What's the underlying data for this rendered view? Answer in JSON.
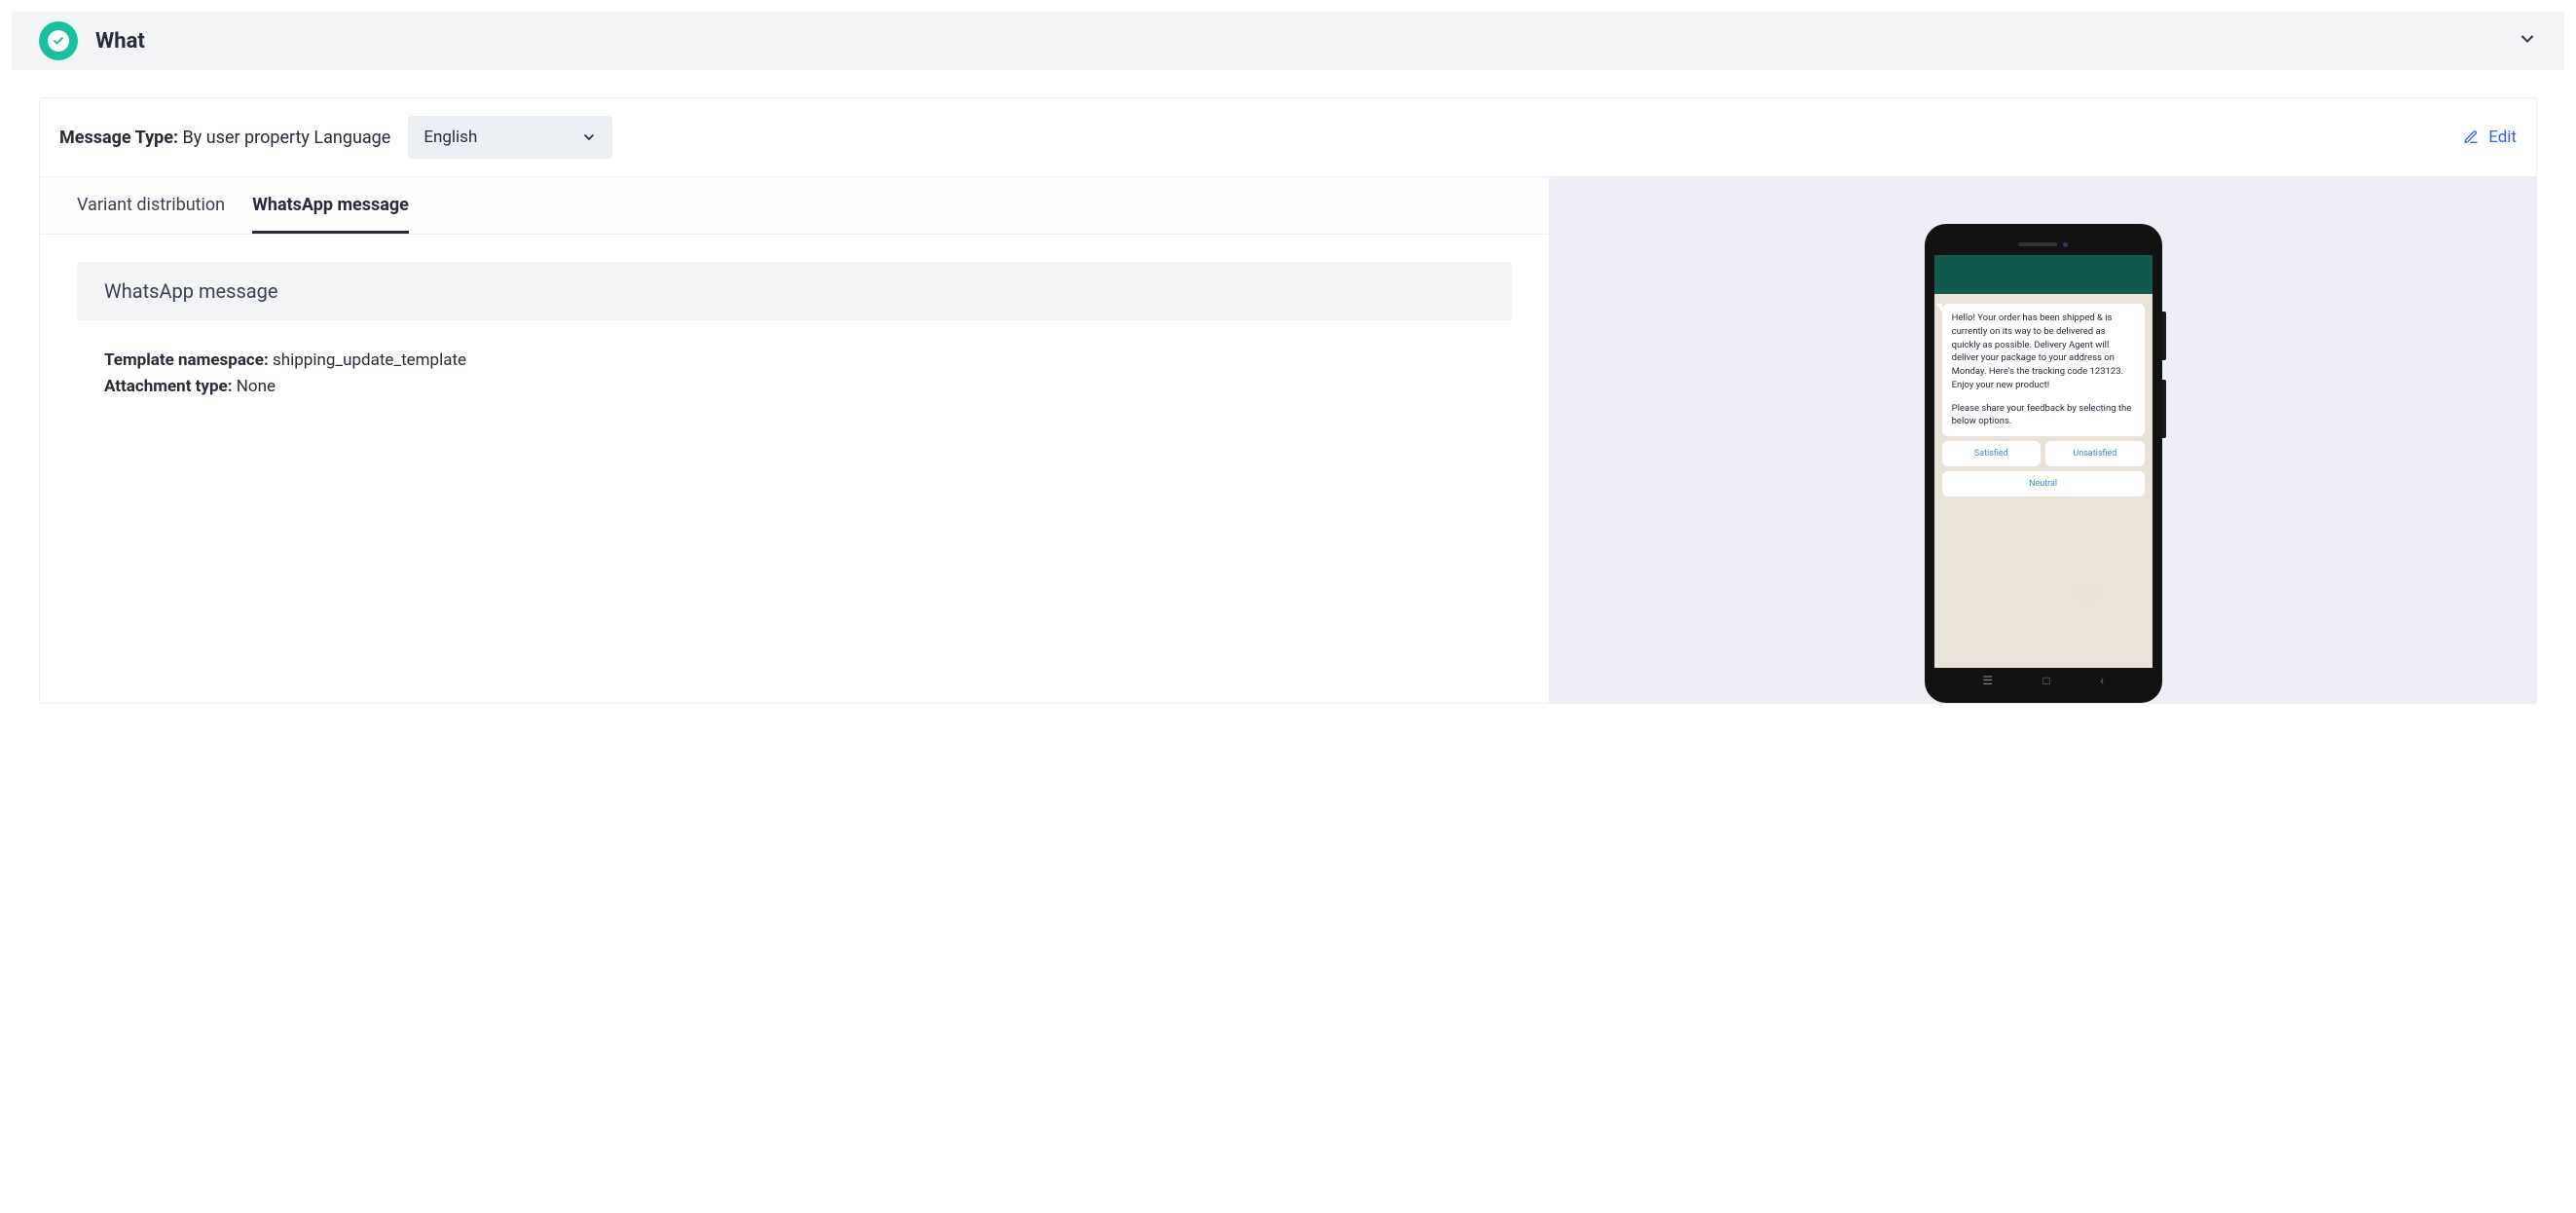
{
  "section": {
    "title": "What"
  },
  "messageType": {
    "label_prefix": "Message Type:",
    "label_value": "By user property Language",
    "selected_language": "English"
  },
  "edit_label": "Edit",
  "tabs": [
    {
      "label": "Variant distribution",
      "active": false
    },
    {
      "label": "WhatsApp message",
      "active": true
    }
  ],
  "subheader": "WhatsApp message",
  "template": {
    "namespace_label": "Template namespace:",
    "namespace_value": "shipping_update_template",
    "attachment_label": "Attachment type:",
    "attachment_value": "None"
  },
  "preview": {
    "message_body_1": "Hello! Your order has been shipped & is currently on its way to be delivered as quickly as possible. Delivery Agent will deliver your package to your address on Monday. Here's the tracking code 123123. Enjoy your new product!",
    "message_body_2": "Please share your feedback by selecting the below options.",
    "buttons": {
      "satisfied": "Satisfied",
      "unsatisfied": "Unsatisfied",
      "neutral": "Neutral"
    }
  }
}
